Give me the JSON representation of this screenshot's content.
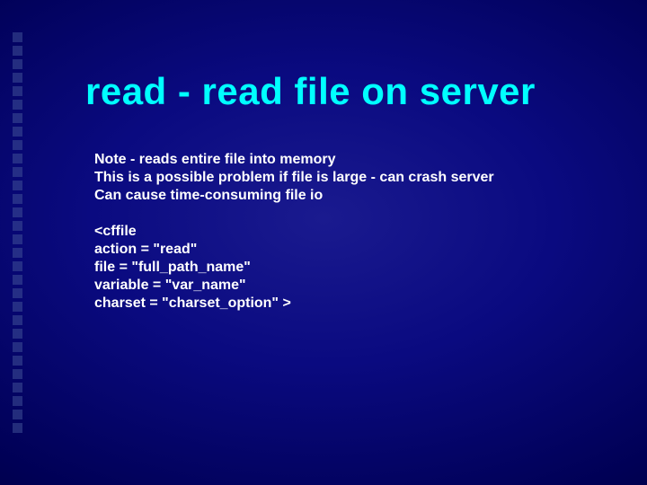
{
  "title": "read - read file on server",
  "notes": {
    "line1": "Note - reads entire file into memory",
    "line2": "This is a possible problem if file is large - can crash server",
    "line3": "Can cause time-consuming file io"
  },
  "code": {
    "l1": "<cffile",
    "l2": "action = \"read\"",
    "l3": "file = \"full_path_name\"",
    "l4": "variable = \"var_name\"",
    "l5": "charset = \"charset_option\" >"
  }
}
